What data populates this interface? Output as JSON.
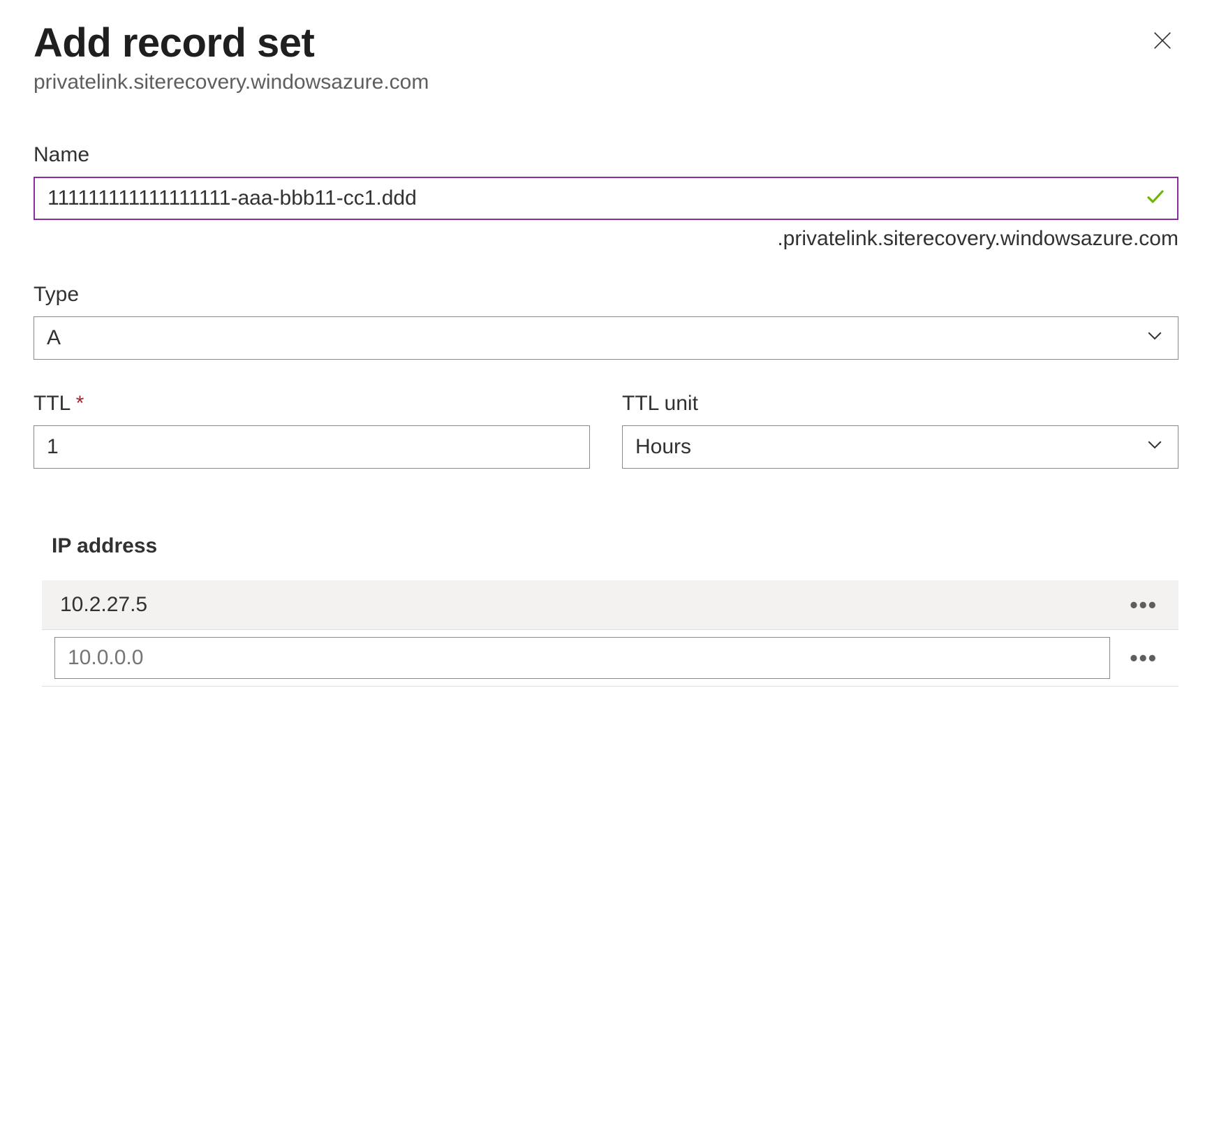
{
  "header": {
    "title": "Add record set",
    "subtitle": "privatelink.siterecovery.windowsazure.com"
  },
  "fields": {
    "name": {
      "label": "Name",
      "value": "111111111111111111-aaa-bbb11-cc1.ddd",
      "suffix": ".privatelink.siterecovery.windowsazure.com"
    },
    "type": {
      "label": "Type",
      "value": "A"
    },
    "ttl": {
      "label": "TTL",
      "value": "1"
    },
    "ttl_unit": {
      "label": "TTL unit",
      "value": "Hours"
    }
  },
  "ip": {
    "heading": "IP address",
    "rows": [
      "10.2.27.5"
    ],
    "placeholder": "10.0.0.0"
  }
}
